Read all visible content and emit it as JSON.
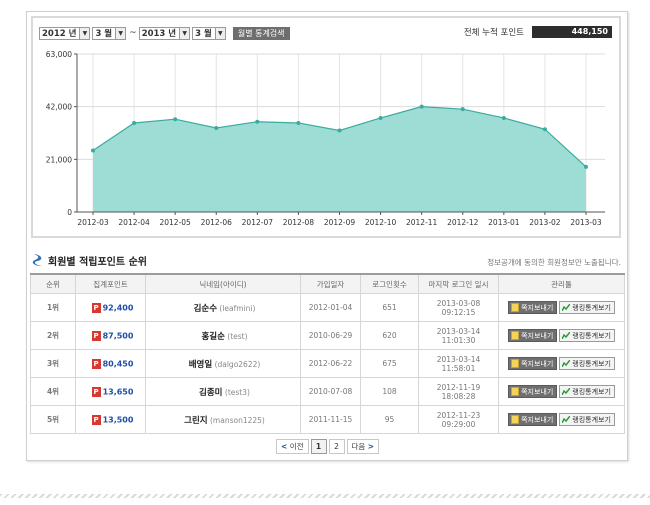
{
  "filter": {
    "start_year": "2012 년",
    "start_month": "3 월",
    "tilde": "~",
    "end_year": "2013 년",
    "end_month": "3 월",
    "search_label": "월별 통계검색",
    "dropdown_icon": "chevron-down-icon"
  },
  "total": {
    "label": "전체 누적 포인트",
    "value": "448,150"
  },
  "chart_data": {
    "type": "area",
    "categories": [
      "2012-03",
      "2012-04",
      "2012-05",
      "2012-06",
      "2012-07",
      "2012-08",
      "2012-09",
      "2012-10",
      "2012-11",
      "2012-12",
      "2013-01",
      "2013-02",
      "2013-03"
    ],
    "values": [
      24500,
      35500,
      37000,
      33500,
      36000,
      35500,
      32500,
      37500,
      42000,
      41000,
      37500,
      33000,
      18000
    ],
    "ylim": [
      0,
      63000
    ],
    "yticks": [
      0,
      21000,
      42000,
      63000
    ],
    "ytick_labels": [
      "0",
      "21,000",
      "42,000",
      "63,000"
    ],
    "grid": true,
    "fill_color": "#9dddd5",
    "line_color": "#3aab9e"
  },
  "ranking": {
    "title": "회원별 적립포인트 순위",
    "note": "정보공개에 동의한 회원정보만 노출됩니다.",
    "headers": [
      "순위",
      "집계포인트",
      "닉네임(아이디)",
      "가입일자",
      "로그인횟수",
      "마지막 로그인 일시",
      "관리툴"
    ],
    "point_badge": "P",
    "message_button": "쪽지보내기",
    "stats_button": "랭킹통계보기",
    "rows": [
      {
        "rank": "1위",
        "points": "92,400",
        "nick": "김순수",
        "user_id": "(leafmini)",
        "joined": "2012-01-04",
        "logins": "651",
        "last_login": "2013-03-08 09:12:15"
      },
      {
        "rank": "2위",
        "points": "87,500",
        "nick": "홍길순",
        "user_id": "(test)",
        "joined": "2010-06-29",
        "logins": "620",
        "last_login": "2013-03-14 11:01:30"
      },
      {
        "rank": "3위",
        "points": "80,450",
        "nick": "배영일",
        "user_id": "(dalgo2622)",
        "joined": "2012-06-22",
        "logins": "675",
        "last_login": "2013-03-14 11:58:01"
      },
      {
        "rank": "4위",
        "points": "13,650",
        "nick": "김종미",
        "user_id": "(test3)",
        "joined": "2010-07-08",
        "logins": "108",
        "last_login": "2012-11-19 18:08:28"
      },
      {
        "rank": "5위",
        "points": "13,500",
        "nick": "그린지",
        "user_id": "(manson1225)",
        "joined": "2011-11-15",
        "logins": "95",
        "last_login": "2012-11-23 09:29:00"
      }
    ]
  },
  "pagination": {
    "prev": "이전",
    "next": "다음",
    "pages": [
      "1",
      "2"
    ],
    "current": "1",
    "prev_icon": "<",
    "next_icon": ">"
  }
}
